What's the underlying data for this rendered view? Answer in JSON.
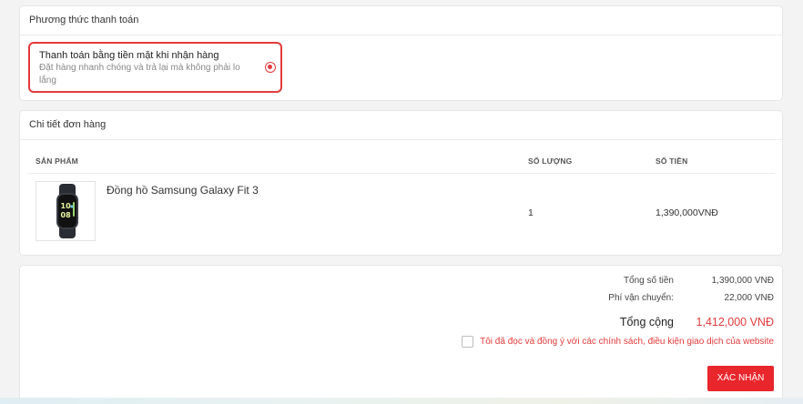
{
  "payment": {
    "header": "Phương thức thanh toán",
    "option_title": "Thanh toán bằng tiền mặt khi nhận hàng",
    "option_desc": "Đặt hàng nhanh chóng và trả lại mà không phải lo lắng",
    "selected": true
  },
  "order": {
    "header": "Chi tiết đơn hàng",
    "columns": [
      "SẢN PHẨM",
      "SỐ LƯỢNG",
      "SỐ TIỀN"
    ],
    "items": [
      {
        "name": "Đồng hồ Samsung Galaxy Fit 3",
        "qty": "1",
        "price": "1,390,000VNĐ",
        "image_icon": "smartwatch-icon"
      }
    ]
  },
  "summary": {
    "subtotal_label": "Tổng số tiền",
    "subtotal_value": "1,390,000 VNĐ",
    "shipping_label": "Phí vận chuyển:",
    "shipping_value": "22,000 VNĐ",
    "total_label": "Tổng cộng",
    "total_value": "1,412,000 VNĐ",
    "agree_text": "Tôi đã đọc và đồng ý với các chính sách, điều kiện giao dịch của website",
    "agree_checked": false,
    "confirm_label": "XÁC NHẬN"
  },
  "colors": {
    "accent": "#e23b3b",
    "button": "#e8262c"
  }
}
